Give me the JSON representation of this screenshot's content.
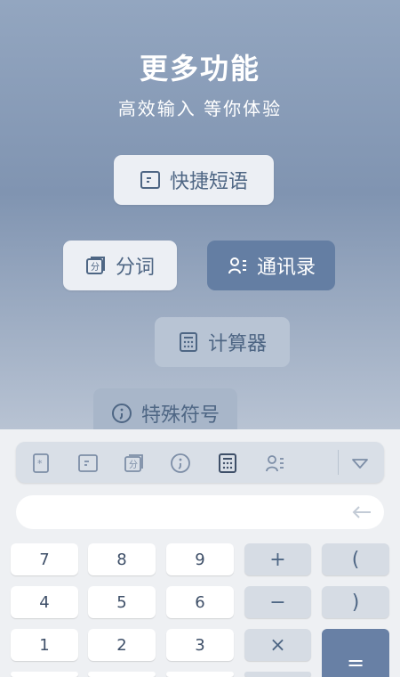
{
  "hero": {
    "title": "更多功能",
    "subtitle": "高效输入 等你体验",
    "features": [
      {
        "label": "快捷短语",
        "icon": "quick-phrase-icon"
      },
      {
        "label": "分词",
        "icon": "word-segment-icon"
      },
      {
        "label": "通讯录",
        "icon": "contacts-icon"
      },
      {
        "label": "计算器",
        "icon": "calculator-icon"
      },
      {
        "label": "特殊符号",
        "icon": "special-symbol-icon"
      }
    ]
  },
  "toolbar": {
    "icons": [
      "asterisk-icon",
      "quick-phrase-icon",
      "word-segment-icon",
      "special-symbol-icon",
      "calculator-icon",
      "contacts-icon",
      "collapse-triangle-icon"
    ],
    "active": "calculator-icon"
  },
  "input": {
    "value": "",
    "backspace_icon": "backspace-arrow-icon"
  },
  "keypad": {
    "numbers": [
      "7",
      "8",
      "9",
      "4",
      "5",
      "6",
      "1",
      "2",
      "3"
    ],
    "ops": [
      "+",
      "(",
      "−",
      ")",
      "×"
    ],
    "equals": "="
  },
  "colors": {
    "accent": "#647ea3",
    "icon": "#4e6684",
    "hero_top": "#93a6c0"
  }
}
